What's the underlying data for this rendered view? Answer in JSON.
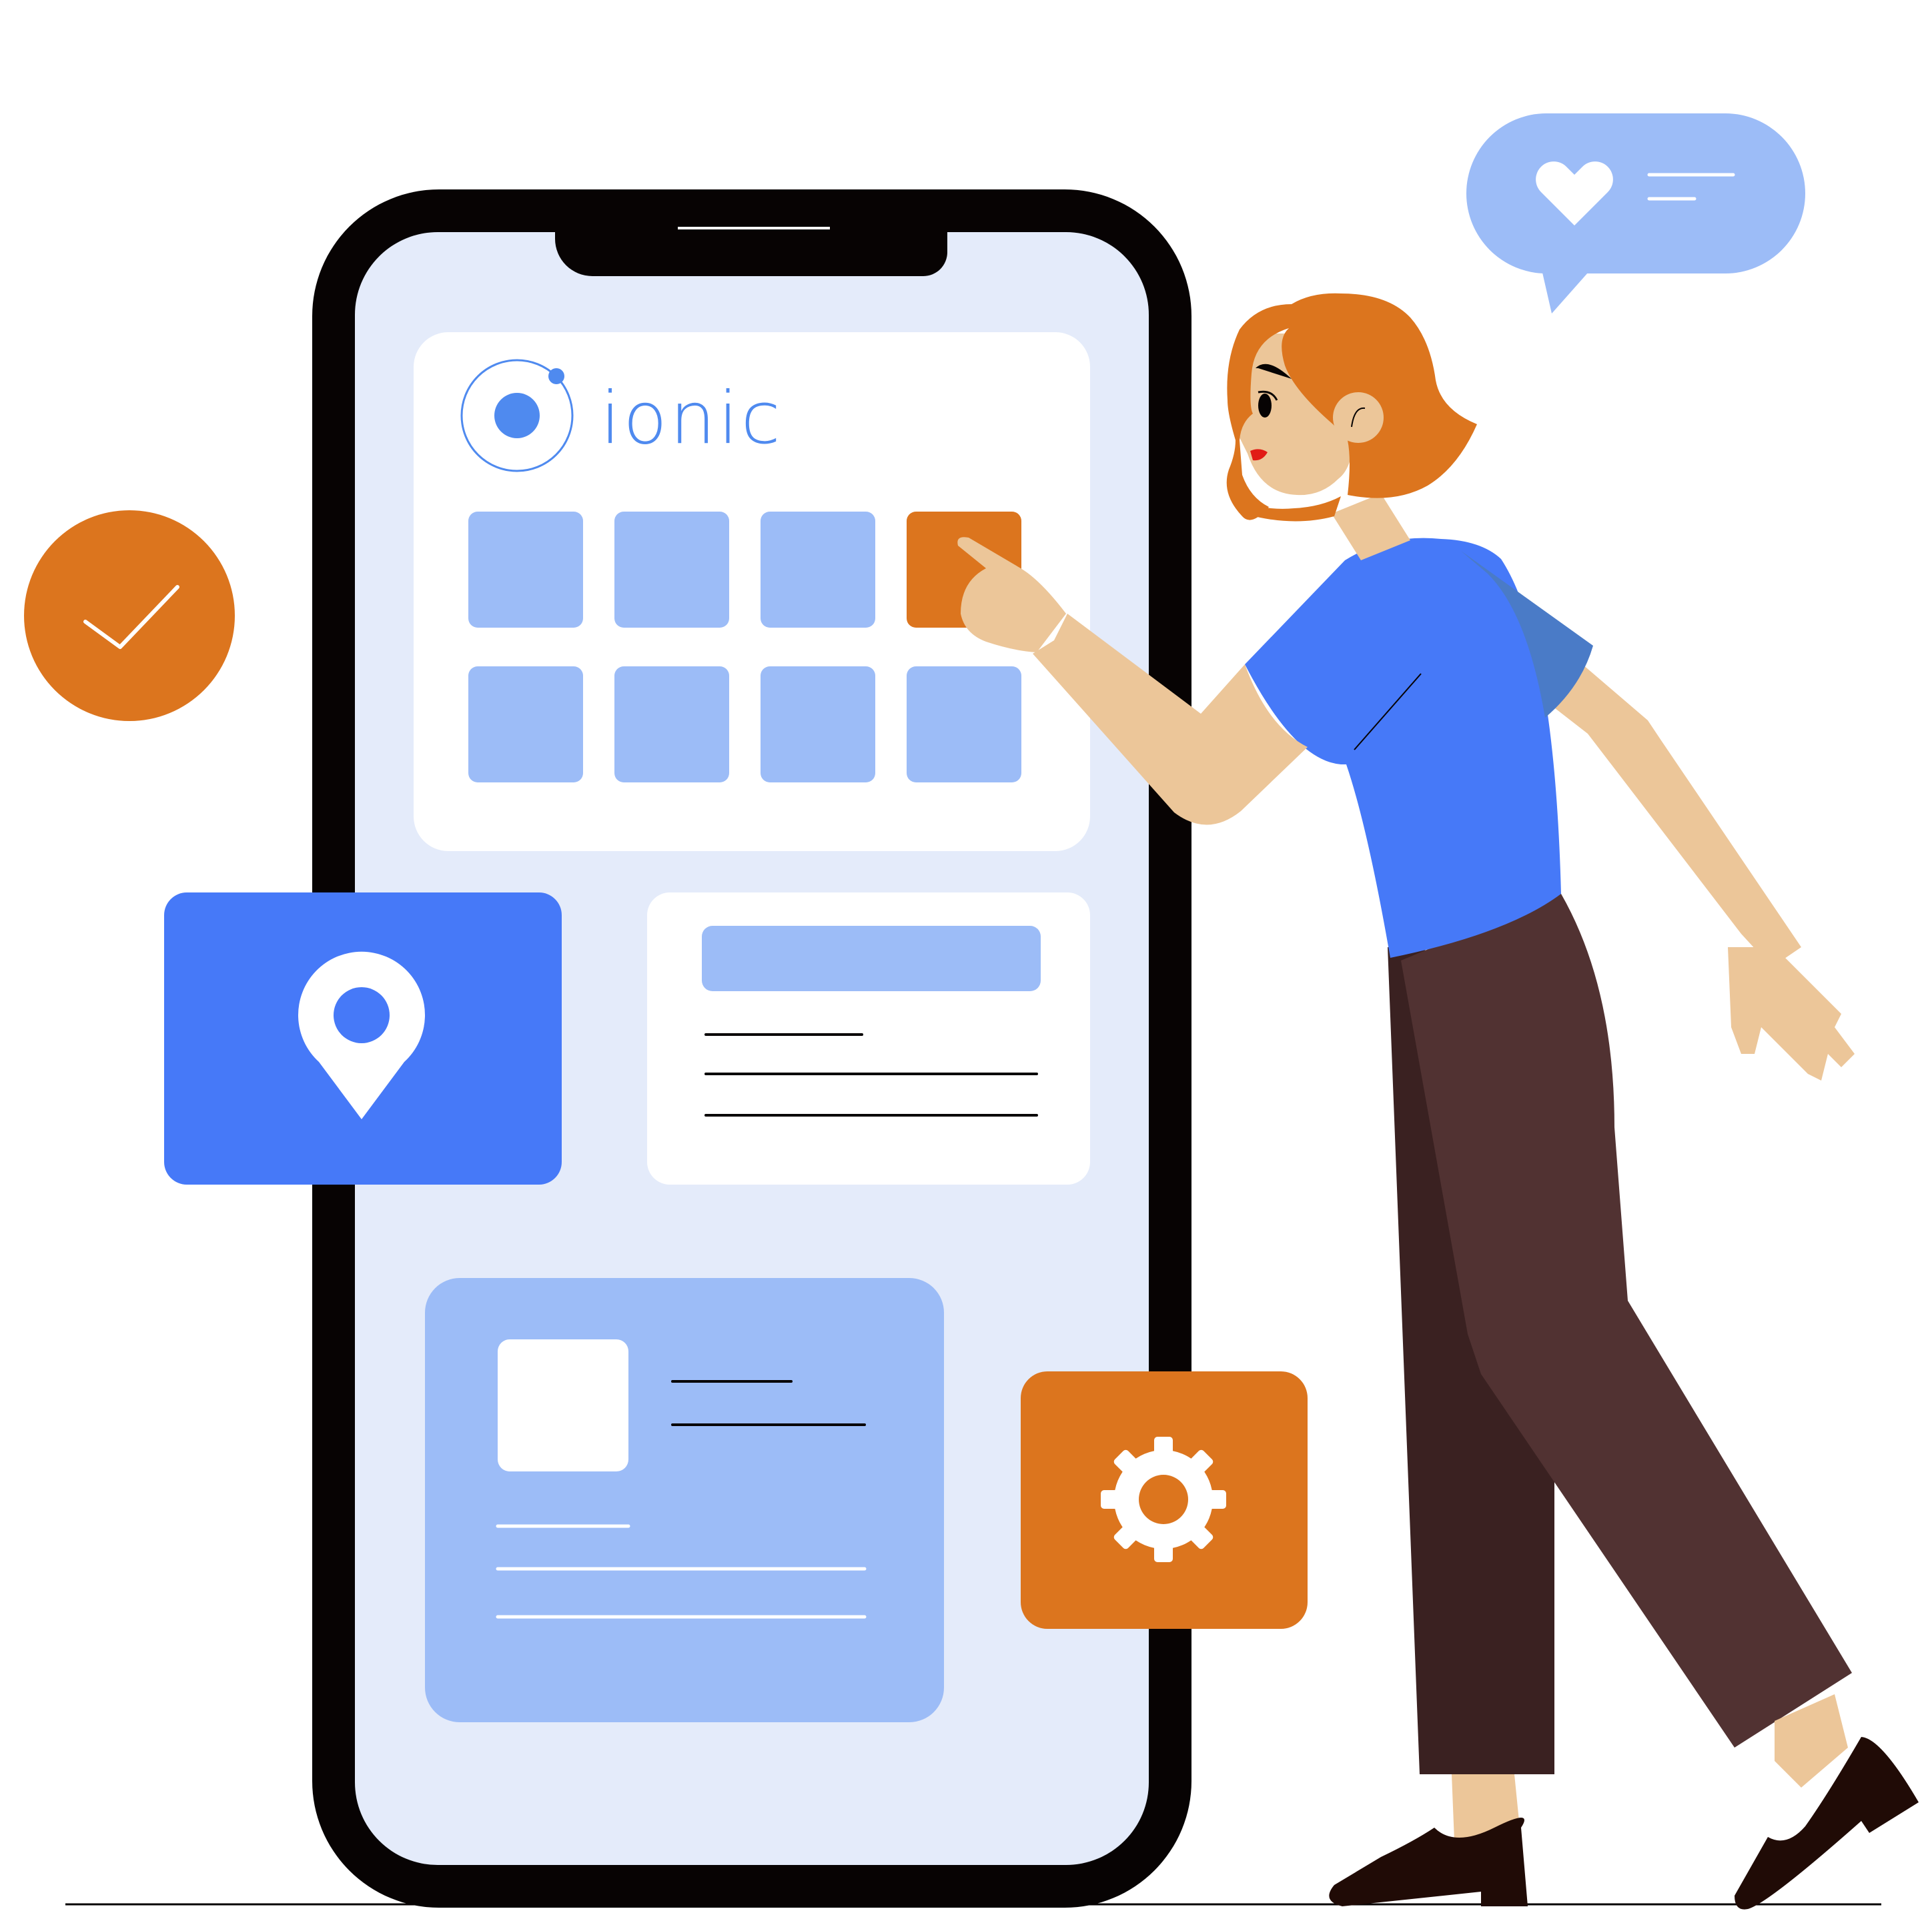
{
  "logo": {
    "wordmark": "ionic"
  },
  "colors": {
    "phone_frame": "#070303",
    "phone_screen": "#e4ebfa",
    "card_white": "#ffffff",
    "tile_light_blue": "#9cbcf7",
    "accent_blue": "#4679f8",
    "accent_orange": "#dc751e",
    "skin": "#ecc699",
    "hair": "#dc751e",
    "shirt": "#4679f8",
    "pants": "#513232",
    "pants_shadow": "#3a2121",
    "shoes": "#200b06"
  },
  "icons": {
    "check_badge": "check-icon",
    "location_card": "location-pin-icon",
    "settings_card": "gear-icon",
    "speech_bubble": "heart-icon"
  },
  "grid": {
    "rows": 2,
    "columns": 4,
    "highlighted_tile": {
      "row": 1,
      "column": 4
    }
  }
}
